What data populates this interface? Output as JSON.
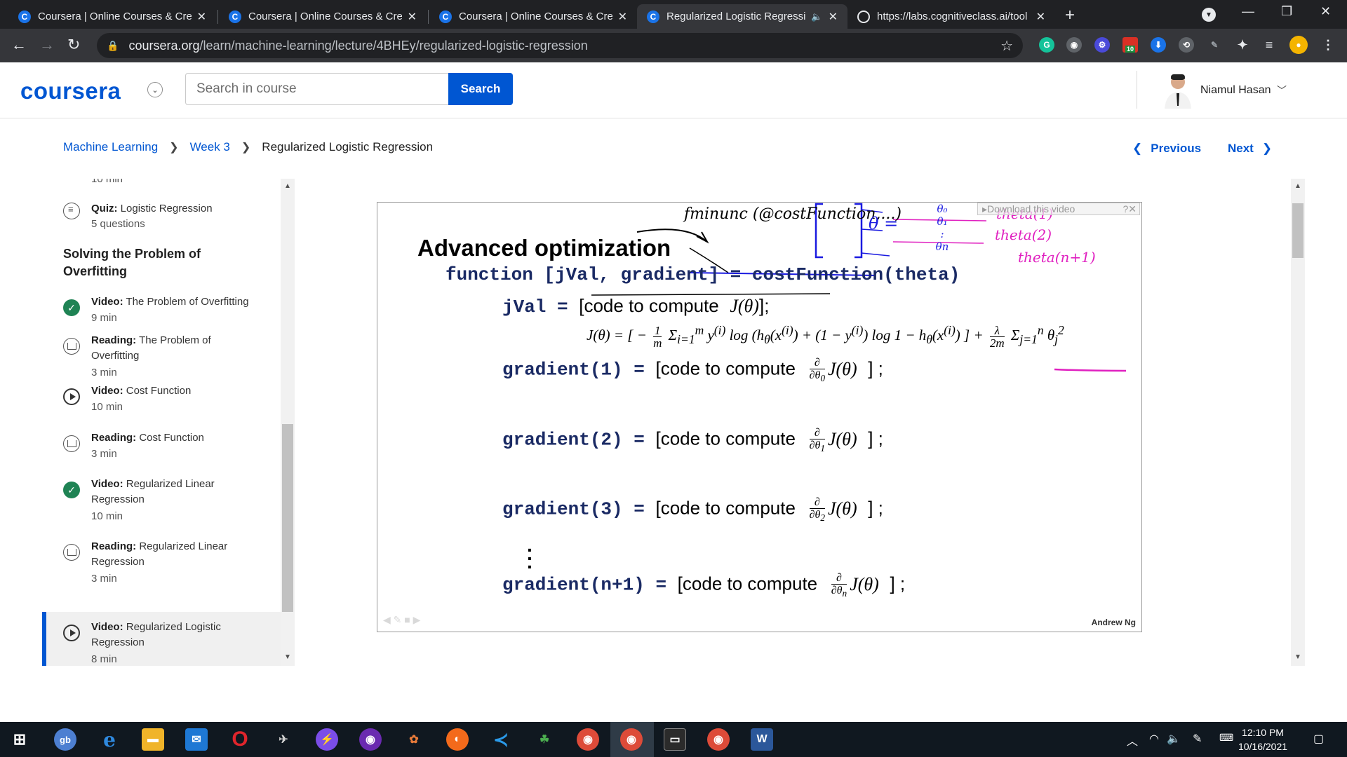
{
  "browser": {
    "tabs": [
      {
        "title": "Coursera | Online Courses & Crec",
        "icon": "coursera-favicon",
        "active": false
      },
      {
        "title": "Coursera | Online Courses & Crec",
        "icon": "coursera-favicon",
        "active": false
      },
      {
        "title": "Coursera | Online Courses & Crec",
        "icon": "coursera-favicon",
        "active": false
      },
      {
        "title": "Regularized Logistic Regressi",
        "icon": "coursera-favicon",
        "active": true
      },
      {
        "title": "https://labs.cognitiveclass.ai/tool",
        "icon": "globe-icon",
        "active": false
      }
    ],
    "url_domain": "coursera.org",
    "url_path": "/learn/machine-learning/lecture/4BHEy/regularized-logistic-regression",
    "extension_badge": "10"
  },
  "header": {
    "logo": "coursera",
    "search_placeholder": "Search in course",
    "search_button": "Search",
    "user_name": "Niamul Hasan"
  },
  "breadcrumb": {
    "course": "Machine Learning",
    "week": "Week 3",
    "current": "Regularized Logistic Regression",
    "previous": "Previous",
    "next": "Next"
  },
  "sidebar": {
    "top_partial": "10 min",
    "quiz": {
      "type": "Quiz:",
      "title": "Logistic Regression",
      "meta": "5 questions"
    },
    "section_title_1": "Solving the Problem of",
    "section_title_2": "Overfitting",
    "items": [
      {
        "type": "Video:",
        "title_1": "The Problem of Overfitting",
        "title_2": "",
        "duration": "9 min",
        "status": "completed"
      },
      {
        "type": "Reading:",
        "title_1": "The Problem of",
        "title_2": "Overfitting",
        "duration": "3 min",
        "status": "reading"
      },
      {
        "type": "Video:",
        "title_1": "Cost Function",
        "title_2": "",
        "duration": "10 min",
        "status": "video"
      },
      {
        "type": "Reading:",
        "title_1": "Cost Function",
        "title_2": "",
        "duration": "3 min",
        "status": "reading"
      },
      {
        "type": "Video:",
        "title_1": "Regularized Linear",
        "title_2": "Regression",
        "duration": "10 min",
        "status": "completed"
      },
      {
        "type": "Reading:",
        "title_1": "Regularized Linear",
        "title_2": "Regression",
        "duration": "3 min",
        "status": "reading"
      },
      {
        "type": "Video:",
        "title_1": "Regularized Logistic",
        "title_2": "Regression",
        "duration": "8 min",
        "status": "active"
      }
    ]
  },
  "video": {
    "title": "Advanced optimization",
    "line_function": "function [jVal, gradient] = costFunction(theta)",
    "jval_lhs": "jVal",
    "eq": "=",
    "code_to_compute": "[code to compute",
    "jtheta": "J(θ)",
    "close": "];",
    "close_spaced": "] ;",
    "gradients": [
      {
        "lhs": "gradient(1)",
        "sub": "0"
      },
      {
        "lhs": "gradient(2)",
        "sub": "1"
      },
      {
        "lhs": "gradient(3)",
        "sub": "2"
      },
      {
        "lhs": "gradient(n+1)",
        "sub": "n"
      }
    ],
    "download_label": "Download this video",
    "author": "Andrew Ng",
    "handwriting": {
      "fminunc": "fminunc (@costFunction,...)",
      "theta_eq": "θ =",
      "theta1": "theta(1)",
      "theta2": "theta(2)",
      "thetan": "theta(n+1)",
      "vec_0": "θ₀",
      "vec_1": "θ₁",
      "vec_dots": ":",
      "vec_n": "θn"
    }
  },
  "taskbar": {
    "time": "12:10 PM",
    "date": "10/16/2021"
  }
}
